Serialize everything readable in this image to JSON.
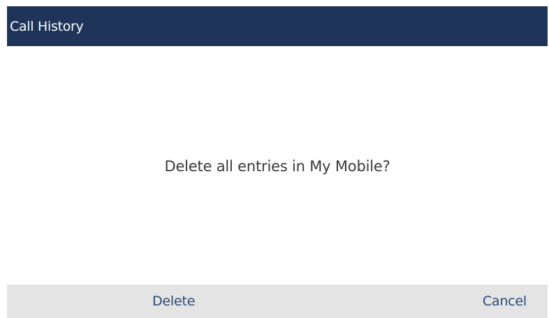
{
  "header": {
    "title": "Call History"
  },
  "dialog": {
    "message": "Delete all entries in My Mobile?"
  },
  "softkeys": {
    "delete_label": "Delete",
    "cancel_label": "Cancel"
  },
  "colors": {
    "title_bar": "#1e3559",
    "softkey_bar": "#e4e4e4",
    "softkey_text": "#274a7a"
  }
}
